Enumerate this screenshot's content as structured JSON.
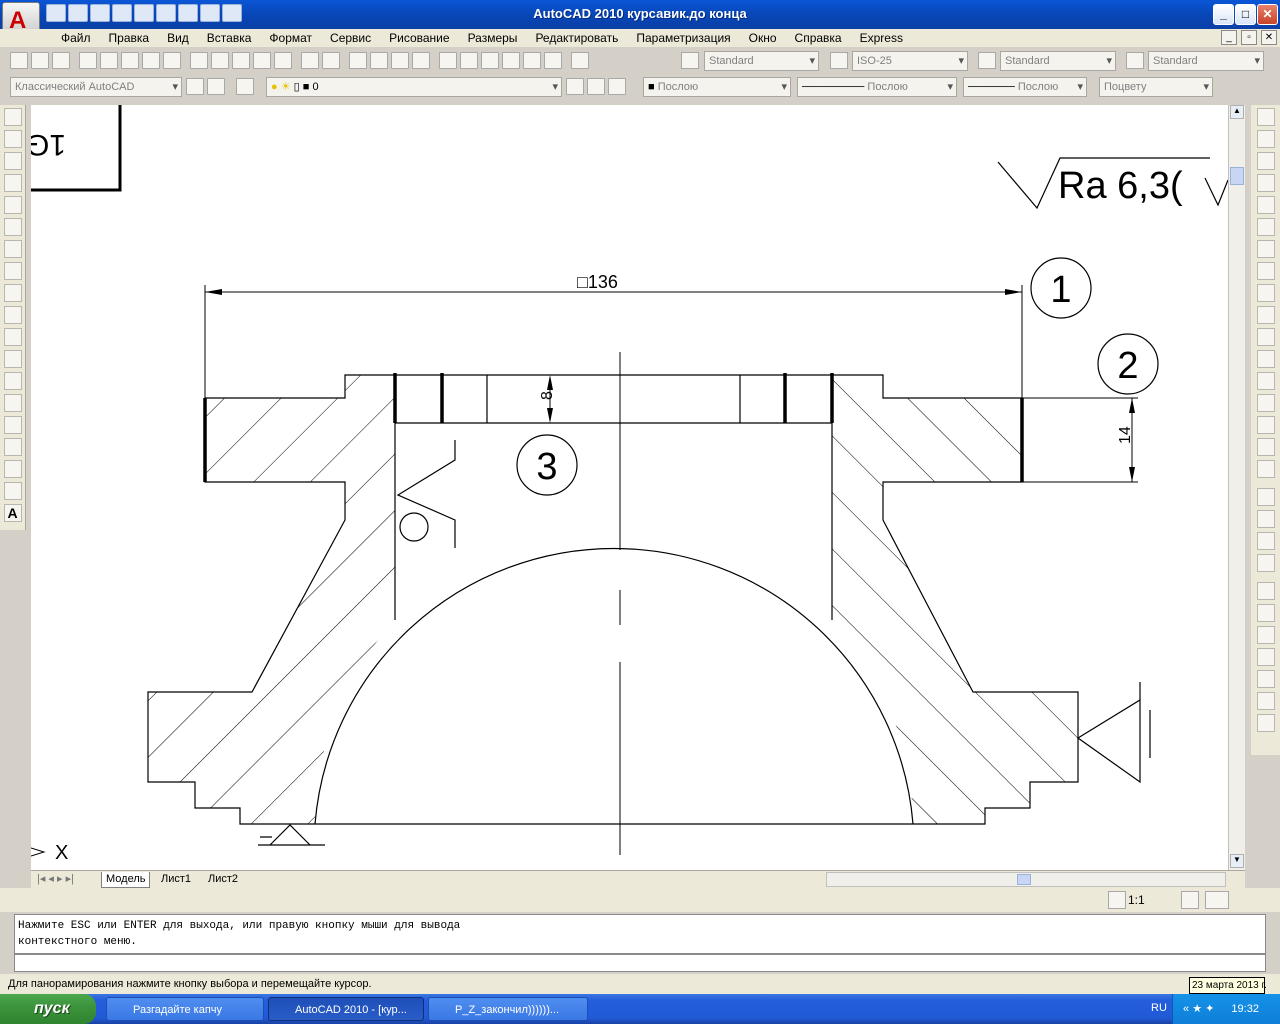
{
  "window": {
    "title": "AutoCAD 2010    курсавик.до конца",
    "app_letter": "A",
    "minimize": "_",
    "maximize": "□",
    "close": "✕"
  },
  "menu": [
    "Файл",
    "Правка",
    "Вид",
    "Вставка",
    "Формат",
    "Сервис",
    "Рисование",
    "Размеры",
    "Редактировать",
    "Параметризация",
    "Окно",
    "Справка",
    "Express"
  ],
  "toolbar1": {
    "text_style": "Standard",
    "dim_style": "ISO-25",
    "table_style": "Standard",
    "mleader_style": "Standard"
  },
  "toolbar2": {
    "workspace": "Классический AutoCAD",
    "layer": "0",
    "color": "Послою",
    "linetype": "Послою",
    "lineweight": "Послою",
    "plotstyle": "Поцвету"
  },
  "drawing": {
    "dim_136": "□136",
    "dim_8": "8",
    "dim_14": "14",
    "balloon_1": "1",
    "balloon_2": "2",
    "balloon_3": "3",
    "roughness": "Ra 6,3(",
    "corner_number": "1G",
    "y_axis_marker": "X"
  },
  "tabs": [
    "Модель",
    "Лист1",
    "Лист2"
  ],
  "status": {
    "scale": "1:1",
    "command_history": "Нажмите ESC или ENTER для выхода, или правую кнопку мыши для вывода\nконтекстного меню.",
    "hint": "Для панорамирования нажмите кнопку выбора и перемещайте курсор."
  },
  "taskbar": {
    "start": "пуск",
    "tasks": [
      "Разгадайте капчу",
      "AutoCAD 2010 - [кур...",
      "P_Z_закончил))))))..."
    ],
    "lang": "RU",
    "time": "19:32",
    "date_tooltip": "23 марта 2013 г."
  },
  "colors": {
    "titlebar": "#0a56d6",
    "canvas": "#ffffff",
    "start": "#3c943c",
    "taskbar": "#245edb"
  }
}
